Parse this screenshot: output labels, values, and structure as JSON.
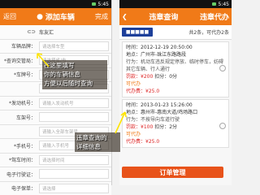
{
  "left": {
    "status_time": "5:45",
    "back_label": "返回",
    "title": "添加车辆",
    "done_label": "完成",
    "logo_text": "车友汇",
    "fields": [
      {
        "label": "车辆品牌：",
        "value": "请选择车型"
      },
      {
        "label": "*查询交管局：",
        "value": "请选择省/市"
      },
      {
        "label": "*车牌号：",
        "value": "请选择车牌前缀"
      },
      {
        "label": "",
        "value": ""
      },
      {
        "label": "*发动机号：",
        "value": "请输入发动机号"
      },
      {
        "label": "车架号：",
        "value": ""
      },
      {
        "label": "",
        "value": "请输入全部车架号"
      },
      {
        "label": "*手机号：",
        "value": "请输入手机号"
      },
      {
        "label": "*驾车时间：",
        "value": "请选择时间"
      },
      {
        "label": "电子行驶证：",
        "value": ""
      },
      {
        "label": "电子保单：",
        "value": "请选择"
      }
    ],
    "callout_text": "在这里填写你的车辆信息方便以后随时查询",
    "callout_lines": [
      "在这里填写",
      "你的车辆信息",
      "方便以后随时查询"
    ]
  },
  "right": {
    "status_time": "5:45",
    "title": "违章查询",
    "right_label": "违章代办",
    "plate": "■■■■■",
    "total_info": "共2条，可代办2条",
    "records": [
      {
        "time": "时间：2012-12-19 20:50:00",
        "place": "地点：广州市-珠江东路路段",
        "action": "行为：机动车违反规定停放、临时停车，妨碍其它车辆、行人通行",
        "fine": "罚款：¥200",
        "points": "扣分：0分",
        "status": "可代办",
        "fee": "代办费：¥25.0"
      },
      {
        "time": "时间：2013-01-23 15:26:00",
        "place": "地点：惠州市-惠南大道/鸡场路口",
        "action": "行为：不按导向车道行驶",
        "fine": "罚款：¥100",
        "points": "扣分：2分",
        "status": "可代办",
        "fee": "代办费：¥25.0"
      }
    ],
    "callout_lines": [
      "违章查询的",
      "详细信息"
    ],
    "pay_label": "订单管理"
  },
  "colors": {
    "accent": "#f07a18",
    "plate": "#1d3f9a",
    "fine": "#d22222"
  }
}
